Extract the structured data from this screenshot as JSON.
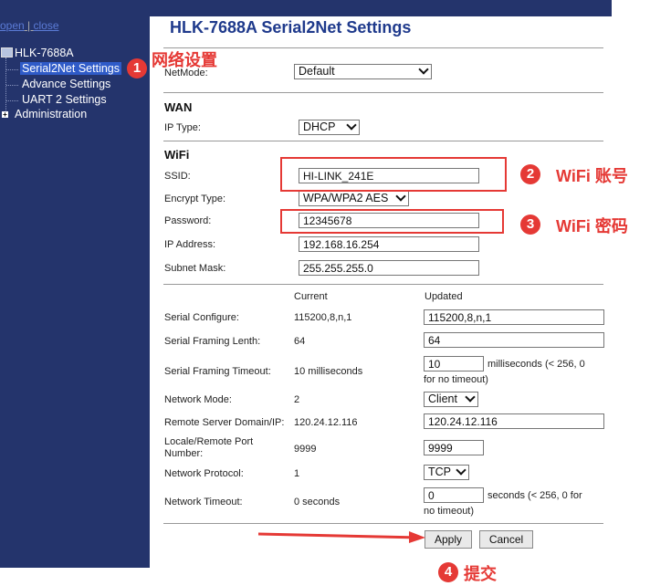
{
  "nav": {
    "open_label": "open",
    "close_label": "close",
    "device": "HLK-7688A",
    "items": [
      {
        "label": "Serial2Net Settings"
      },
      {
        "label": "Advance Settings"
      },
      {
        "label": "UART 2 Settings"
      }
    ],
    "admin": "Administration"
  },
  "page_title": "HLK-7688A Serial2Net Settings",
  "netmode": {
    "label": "NetMode:",
    "value": "Default"
  },
  "wan": {
    "heading": "WAN",
    "ip_type_label": "IP Type:",
    "ip_type_value": "DHCP"
  },
  "wifi": {
    "heading": "WiFi",
    "ssid_label": "SSID:",
    "ssid_value": "HI-LINK_241E",
    "encrypt_label": "Encrypt Type:",
    "encrypt_value": "WPA/WPA2 AES",
    "password_label": "Password:",
    "password_value": "12345678",
    "ip_label": "IP Address:",
    "ip_value": "192.168.16.254",
    "mask_label": "Subnet Mask:",
    "mask_value": "255.255.255.0"
  },
  "serial": {
    "current_header": "Current",
    "updated_header": "Updated",
    "rows": {
      "configure": {
        "label": "Serial Configure:",
        "current": "115200,8,n,1",
        "updated": "115200,8,n,1"
      },
      "framing_length": {
        "label": "Serial Framing Lenth:",
        "current": "64",
        "updated": "64"
      },
      "framing_timeout": {
        "label": "Serial Framing Timeout:",
        "current": "10 milliseconds",
        "updated": "10",
        "note1": "milliseconds (< 256, 0",
        "note2": "for no timeout)"
      },
      "network_mode": {
        "label": "Network Mode:",
        "current": "2",
        "updated": "Client"
      },
      "remote_server": {
        "label": "Remote Server Domain/IP:",
        "current": "120.24.12.116",
        "updated": "120.24.12.116"
      },
      "port": {
        "label1": "Locale/Remote Port",
        "label2": "Number:",
        "current": "9999",
        "updated": "9999"
      },
      "protocol": {
        "label": "Network Protocol:",
        "current": "1",
        "updated": "TCP"
      },
      "timeout": {
        "label": "Network Timeout:",
        "current": "0 seconds",
        "updated": "0",
        "note1": "seconds (< 256, 0 for",
        "note2": "no timeout)"
      }
    }
  },
  "buttons": {
    "apply": "Apply",
    "cancel": "Cancel"
  },
  "annotations": [
    {
      "number": "1",
      "text": "网络设置"
    },
    {
      "number": "2",
      "text": "WiFi 账号"
    },
    {
      "number": "3",
      "text": "WiFi 密码"
    },
    {
      "number": "4",
      "text": "提交"
    }
  ],
  "colors": {
    "sidebar": "#24346c",
    "title": "#1f3a8c",
    "annotation": "#e53935",
    "selected": "#2f5bc8"
  }
}
